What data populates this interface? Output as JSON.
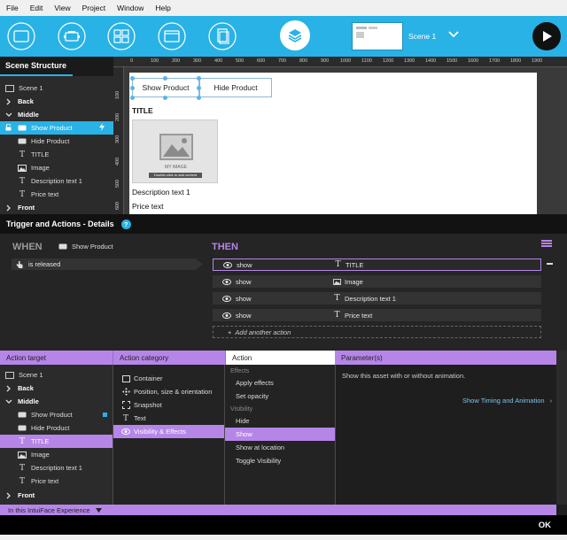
{
  "menu": [
    "File",
    "Edit",
    "View",
    "Project",
    "Window",
    "Help"
  ],
  "toolbar": {
    "scene_name": "Scene 1",
    "icons": [
      "container-icon",
      "interface-asset-icon",
      "collection-icon",
      "window-icon",
      "document-icon",
      "layers-icon",
      "play-icon"
    ],
    "accent": "#29b2e6"
  },
  "scene_structure": {
    "title": "Scene Structure",
    "scene": "Scene 1",
    "layers": {
      "back": "Back",
      "middle": "Middle",
      "front": "Front"
    },
    "items": [
      {
        "label": "Show Product",
        "icon": "button-icon"
      },
      {
        "label": "Hide Product",
        "icon": "button-icon"
      },
      {
        "label": "TITLE",
        "icon": "text-icon"
      },
      {
        "label": "Image",
        "icon": "image-icon"
      },
      {
        "label": "Description text 1",
        "icon": "text-icon"
      },
      {
        "label": "Price text",
        "icon": "text-icon"
      }
    ]
  },
  "canvas": {
    "ruler_h": [
      "0",
      "100",
      "200",
      "300",
      "400",
      "500",
      "600",
      "700",
      "800",
      "900",
      "1000",
      "1100",
      "1200",
      "1300",
      "1400",
      "1500",
      "1600",
      "1700",
      "1800",
      "1900"
    ],
    "ruler_v": [
      "100",
      "200",
      "300",
      "400",
      "500",
      "600"
    ],
    "show_button": "Show Product",
    "hide_button": "Hide Product",
    "title": "TITLE",
    "image_label": "MY IMAGE",
    "image_hint": "Double-click to add content",
    "description": "Description text 1",
    "price": "Price text"
  },
  "trigger_actions": {
    "title": "Trigger and Actions - Details",
    "help": "?",
    "when": "WHEN",
    "then": "THEN",
    "source": "Show Product",
    "event": "is released",
    "actions": [
      {
        "verb": "show",
        "target": "TITLE"
      },
      {
        "verb": "show",
        "target": "Image"
      },
      {
        "verb": "show",
        "target": "Description text 1"
      },
      {
        "verb": "show",
        "target": "Price text"
      }
    ],
    "add_action": "Add another action",
    "then_color": "#b586e8"
  },
  "details": {
    "headers": {
      "target": "Action target",
      "category": "Action category",
      "action": "Action",
      "params": "Parameter(s)"
    },
    "targets": {
      "scene": "Scene 1",
      "back": "Back",
      "middle": "Middle",
      "front": "Front",
      "items": [
        "Show Product",
        "Hide Product",
        "TITLE",
        "Image",
        "Description text 1",
        "Price text"
      ]
    },
    "categories": [
      "Container",
      "Position, size & orientation",
      "Snapshot",
      "Text",
      "Visibility & Effects"
    ],
    "action_groups": {
      "effects": "Effects",
      "effects_items": [
        "Apply effects",
        "Set opacity"
      ],
      "visibility": "Visibility",
      "visibility_items": [
        "Hide",
        "Show",
        "Show at location",
        "Toggle Visibility"
      ]
    },
    "param_desc": "Show this asset with or without animation.",
    "param_link": "Show Timing and Animation"
  },
  "footer": {
    "scope": "In this IntuiFace Experience",
    "ok": "OK"
  }
}
